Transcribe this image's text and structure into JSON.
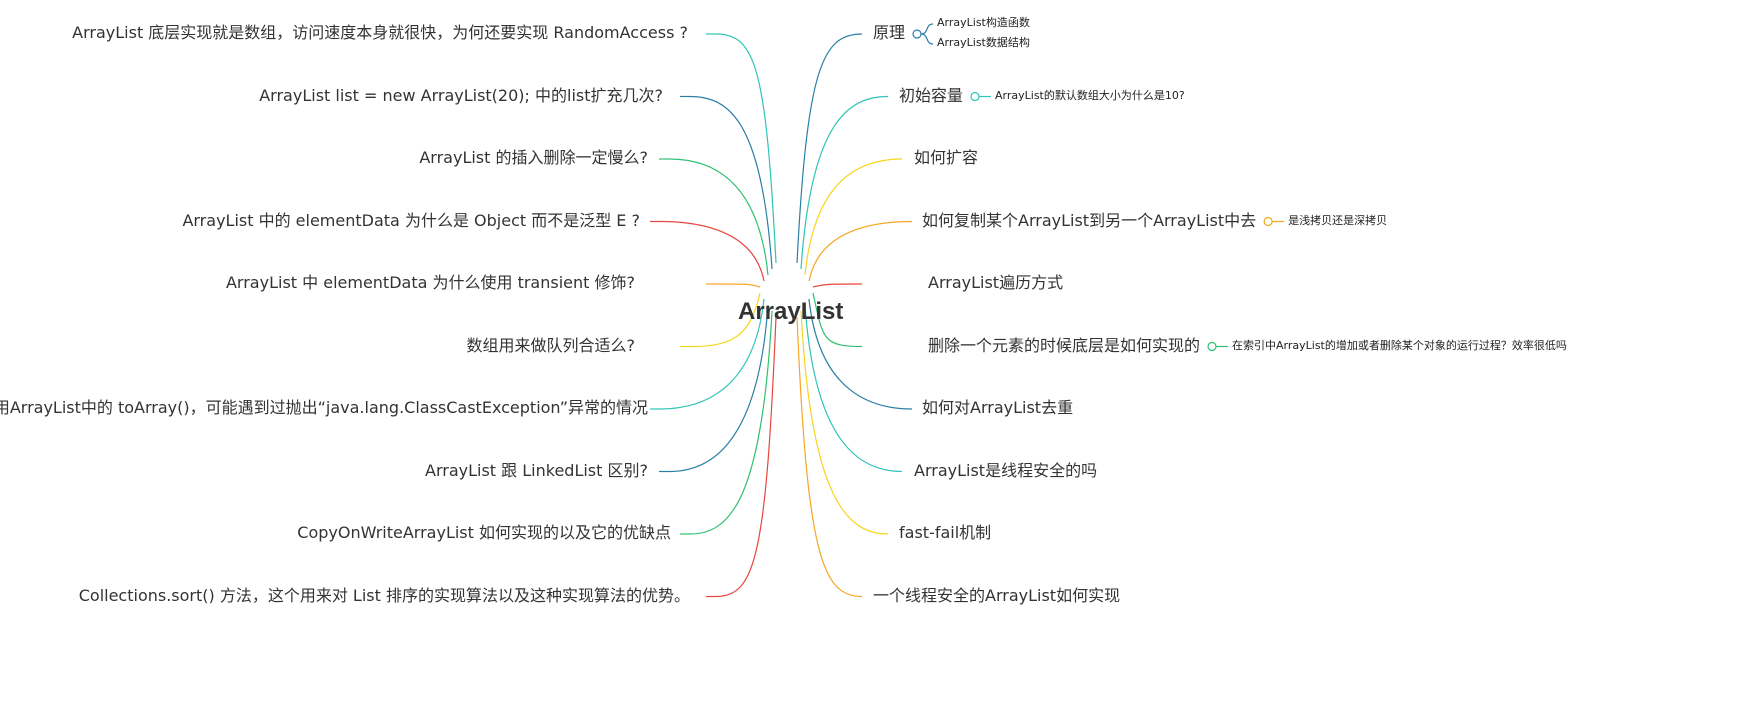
{
  "root": {
    "label": "ArrayList"
  },
  "left_branches": [
    {
      "label": "ArrayList 底层实现就是数组，访问速度本身就很快，为何还要实现 RandomAccess ?",
      "color": "#2ec4b6"
    },
    {
      "label": "ArrayList list = new ArrayList(20); 中的list扩充几次?",
      "color": "#2a7fa6"
    },
    {
      "label": "ArrayList 的插入删除一定慢么?",
      "color": "#2fbf71"
    },
    {
      "label": "ArrayList 中的 elementData 为什么是 Object 而不是泛型 E ?",
      "color": "#e8453c"
    },
    {
      "label": "ArrayList 中 elementData 为什么使用 transient 修饰?",
      "color": "#f5a623"
    },
    {
      "label": "数组用来做队列合适么?",
      "color": "#f7d51d"
    },
    {
      "label": "调用ArrayList中的 toArray()，可能遇到过抛出“java.lang.ClassCastException”异常的情况",
      "color": "#2ec4b6"
    },
    {
      "label": "ArrayList 跟 LinkedList 区别?",
      "color": "#2a7fa6"
    },
    {
      "label": "CopyOnWriteArrayList 如何实现的以及它的优缺点",
      "color": "#2fbf71"
    },
    {
      "label": "Collections.sort() 方法，这个用来对 List 排序的实现算法以及这种实现算法的优势。",
      "color": "#e8453c"
    }
  ],
  "right_branches": [
    {
      "label": "原理",
      "color": "#2a7fa6",
      "children": [
        "ArrayList构造函数",
        "ArrayList数据结构"
      ]
    },
    {
      "label": "初始容量",
      "color": "#2ec4b6",
      "children": [
        "ArrayList的默认数组大小为什么是10?"
      ]
    },
    {
      "label": "如何扩容",
      "color": "#f7d51d",
      "children": []
    },
    {
      "label": "如何复制某个ArrayList到另一个ArrayList中去",
      "color": "#f5a623",
      "children": [
        "是浅拷贝还是深拷贝"
      ]
    },
    {
      "label": "ArrayList遍历方式",
      "color": "#e8453c",
      "children": []
    },
    {
      "label": "删除一个元素的时候底层是如何实现的",
      "color": "#2fbf71",
      "children": [
        "在索引中ArrayList的增加或者删除某个对象的运行过程？效率很低吗"
      ]
    },
    {
      "label": "如何对ArrayList去重",
      "color": "#2a7fa6",
      "children": []
    },
    {
      "label": "ArrayList是线程安全的吗",
      "color": "#2ec4b6",
      "children": []
    },
    {
      "label": "fast-fail机制",
      "color": "#f7d51d",
      "children": []
    },
    {
      "label": "一个线程安全的ArrayList如何实现",
      "color": "#f5a623",
      "children": []
    }
  ]
}
